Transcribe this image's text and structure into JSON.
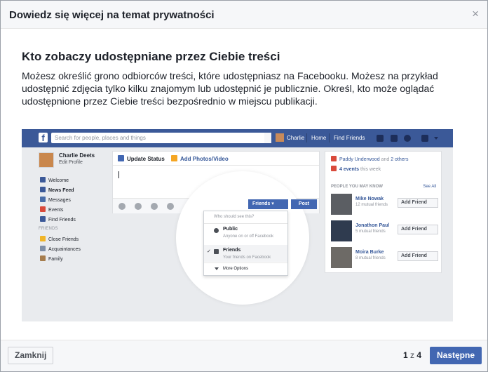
{
  "dialog": {
    "title": "Dowiedz się więcej na temat prywatności",
    "close_glyph": "×"
  },
  "content": {
    "heading": "Kto zobaczy udostępniane przez Ciebie treści",
    "description": "Możesz określić grono odbiorców treści, które udostępniasz na Facebooku. Możesz na przykład udostępnić zdjęcia tylko kilku znajomym lub udostępnić je publicznie. Określ, kto może oglądać udostępnione przez Ciebie treści bezpośrednio w miejscu publikacji."
  },
  "illustration": {
    "topbar": {
      "logo": "f",
      "search_placeholder": "Search for people, places and things",
      "user": "Charlie",
      "home": "Home",
      "find_friends": "Find Friends"
    },
    "left": {
      "name": "Charlie Deets",
      "edit_profile": "Edit Profile",
      "items": [
        {
          "label": "Welcome",
          "color": "#3b5998"
        },
        {
          "label": "News Feed",
          "color": "#3b5998"
        },
        {
          "label": "Messages",
          "color": "#4a6ea9"
        },
        {
          "label": "Events",
          "color": "#d94a3b"
        },
        {
          "label": "Find Friends",
          "color": "#3b5998"
        }
      ],
      "friends_section": "FRIENDS",
      "friends_items": [
        {
          "label": "Close Friends",
          "color": "#f0b528"
        },
        {
          "label": "Acquaintances",
          "color": "#7f8fa6"
        },
        {
          "label": "Family",
          "color": "#a67d4d"
        }
      ]
    },
    "composer": {
      "update_status": "Update Status",
      "add_photos": "Add Photos/Video"
    },
    "audience": {
      "button": "Friends ▾",
      "post": "Post",
      "question": "Who should see this?",
      "public_title": "Public",
      "public_sub": "Anyone on or off Facebook",
      "check": "✓",
      "friends_title": "Friends",
      "friends_sub": "Your friends on Facebook",
      "more_options": "More Options"
    },
    "right": {
      "birthday_name": "Paddy Underwood",
      "birthday_and": "and",
      "birthday_others": "2 others",
      "events_link": "4 events",
      "events_rest": "this week",
      "pymk": "PEOPLE YOU MAY KNOW",
      "see_all": "See All",
      "people": [
        {
          "name": "Mike Nowak",
          "mutual": "12 mutual friends",
          "add": "Add Friend"
        },
        {
          "name": "Jonathon Paul",
          "mutual": "5 mutual friends",
          "add": "Add Friend"
        },
        {
          "name": "Moira Burke",
          "mutual": "8 mutual friends",
          "add": "Add Friend"
        }
      ]
    }
  },
  "footer": {
    "close_button": "Zamknij",
    "page_current": "1",
    "page_sep": "z",
    "page_total": "4",
    "next_button": "Następne"
  }
}
